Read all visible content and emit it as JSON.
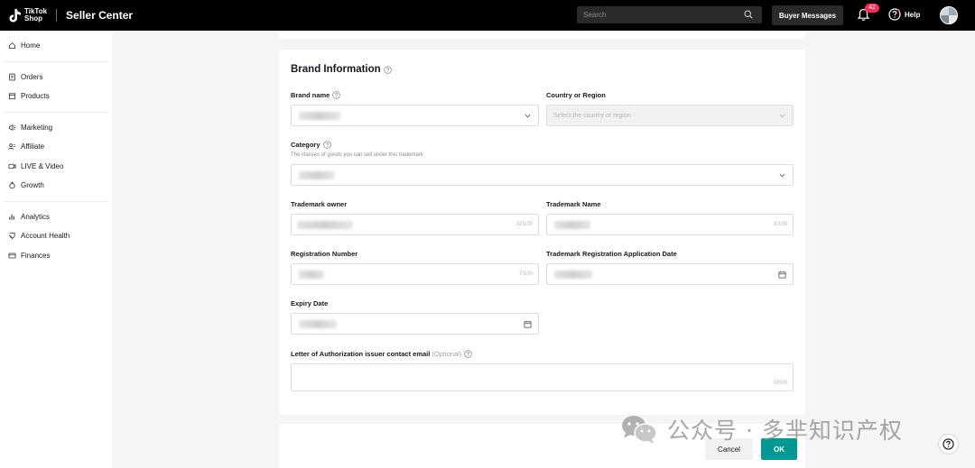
{
  "header": {
    "logo_line1": "TikTok",
    "logo_line2": "Shop",
    "app_title": "Seller Center",
    "search_placeholder": "Search",
    "buyer_messages": "Buyer Messages",
    "notification_count": "42",
    "help": "Help"
  },
  "sidebar": {
    "groups": [
      [
        {
          "label": "Home",
          "icon": "home-icon"
        }
      ],
      [
        {
          "label": "Orders",
          "icon": "orders-icon"
        },
        {
          "label": "Products",
          "icon": "products-icon"
        }
      ],
      [
        {
          "label": "Marketing",
          "icon": "marketing-icon"
        },
        {
          "label": "Affiliate",
          "icon": "affiliate-icon"
        },
        {
          "label": "LIVE & Video",
          "icon": "live-icon"
        },
        {
          "label": "Growth",
          "icon": "growth-icon"
        }
      ],
      [
        {
          "label": "Analytics",
          "icon": "analytics-icon"
        },
        {
          "label": "Account Health",
          "icon": "health-icon"
        },
        {
          "label": "Finances",
          "icon": "finances-icon"
        }
      ]
    ]
  },
  "form": {
    "title": "Brand Information",
    "brand_name_label": "Brand name",
    "country_label": "Country or Region",
    "country_placeholder": "Select the country or region",
    "category_label": "Category",
    "category_hint": "The classes of goods you can sell under this trademark",
    "owner_label": "Trademark owner",
    "owner_counter": "32/100",
    "tm_name_label": "Trademark Name",
    "tm_name_counter": "8/100",
    "reg_number_label": "Registration Number",
    "reg_number_counter": "7/100",
    "app_date_label": "Trademark Registration Application Date",
    "expiry_label": "Expiry Date",
    "email_label": "Letter of Authorization issuer contact email",
    "email_optional": "(Optional)",
    "email_counter": "0/500"
  },
  "actions": {
    "cancel": "Cancel",
    "ok": "OK"
  },
  "watermark": {
    "text": "公众号 · 多芈知识产权"
  },
  "colors": {
    "primary": "#009995",
    "badge": "#fe2c55",
    "topbar": "#000000"
  }
}
